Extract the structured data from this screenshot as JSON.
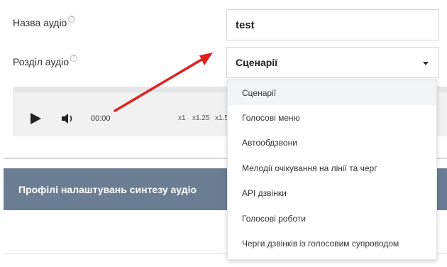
{
  "form": {
    "name_label": "Назва аудіо",
    "name_value": "test",
    "section_label": "Розділ аудіо",
    "section_selected": "Сценарії",
    "help_glyph": "?"
  },
  "player": {
    "time": "00:00",
    "speeds": [
      "x1",
      "x1.25",
      "x1.5"
    ]
  },
  "banner": {
    "title": "Профілі налаштувань синтезу аудіо"
  },
  "dropdown": {
    "options": [
      "Сценарії",
      "Голосові меню",
      "Автообдзвони",
      "Мелодії очікування на лінії та черг",
      "API дзвінки",
      "Голосові роботи",
      "Черги дзвінків із голосовим супроводом"
    ]
  },
  "colors": {
    "banner": "#6b7d93",
    "annotation_arrow": "#e02020"
  }
}
